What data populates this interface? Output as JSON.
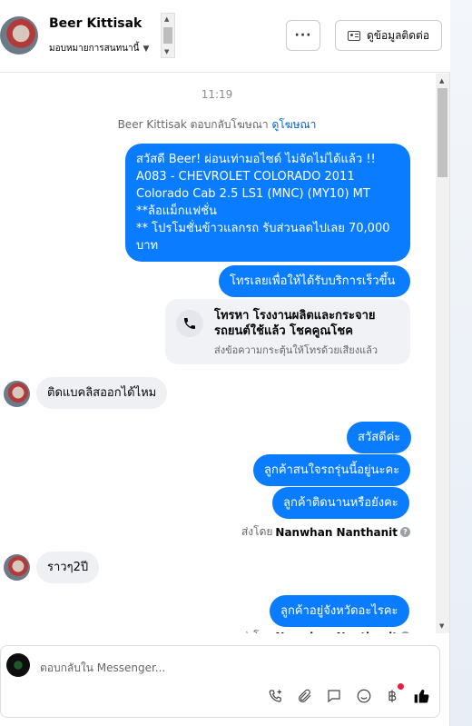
{
  "header": {
    "contact_name": "Beer Kittisak",
    "assign_label": "มอบหมายการสนทนานี้",
    "more_label": "···",
    "contact_info_label": "ดูข้อมูลติดต่อ"
  },
  "chat": {
    "time": "11:19",
    "ad_note_prefix": "Beer Kittisak ตอบกลับโฆษณา",
    "ad_note_link": "ดูโฆษณา",
    "messages": [
      {
        "dir": "out",
        "text": "สวัสดี Beer! ผ่อนเท่ามอไซด์ ไม่จัดไม่ได้แล้ว !!\nA083 - CHEVROLET COLORADO 2011\nColorado Cab 2.5 LS1 (MNC) (MY10) MT **ล้อแม็กแฟชั่น\n** โปรโมชั่นข้าวแลกรถ รับส่วนลดไปเลย 70,000 บาท"
      },
      {
        "dir": "out",
        "text": "โทรเลยเพื่อให้ได้รับบริการเร็วขึ้น"
      },
      {
        "dir": "in",
        "text": "ติดแบคลิสออกได้ไหม"
      },
      {
        "dir": "out",
        "text": "สวัสดีค่ะ"
      },
      {
        "dir": "out",
        "text": "ลูกค้าสนใจรถรุ่นนี้อยู่นะคะ"
      },
      {
        "dir": "out",
        "text": "ลูกค้าติดนานหรือยังคะ"
      },
      {
        "dir": "in",
        "text": "ราวๆ2ปี"
      },
      {
        "dir": "out",
        "text": "ลูกค้าอยู่จังหวัดอะไรคะ"
      }
    ],
    "call_card": {
      "title": "โทรหา โรงงานผลิตและกระจายรถยนต์ใช้แล้ว โชคคูณโชค",
      "subtitle": "ส่งข้อความกระตุ้นให้โทรด้วยเสียงแล้ว"
    },
    "sent_by_prefix": "ส่งโดย",
    "sent_by_name": "Nanwhan Nanthanit",
    "info_glyph": "?"
  },
  "composer": {
    "placeholder": "ตอบกลับใน Messenger..."
  },
  "icons": [
    "chevron-down-icon",
    "more-icon",
    "contact-card-icon",
    "phone-icon",
    "phone-add-icon",
    "paperclip-icon",
    "chat-bubble-icon",
    "emoji-icon",
    "baht-icon",
    "thumbs-up-icon"
  ],
  "colors": {
    "outgoing_bubble": "#0a7cff",
    "incoming_bubble": "#eef0f3",
    "link": "#0064d1",
    "notification": "#e41e3f"
  }
}
